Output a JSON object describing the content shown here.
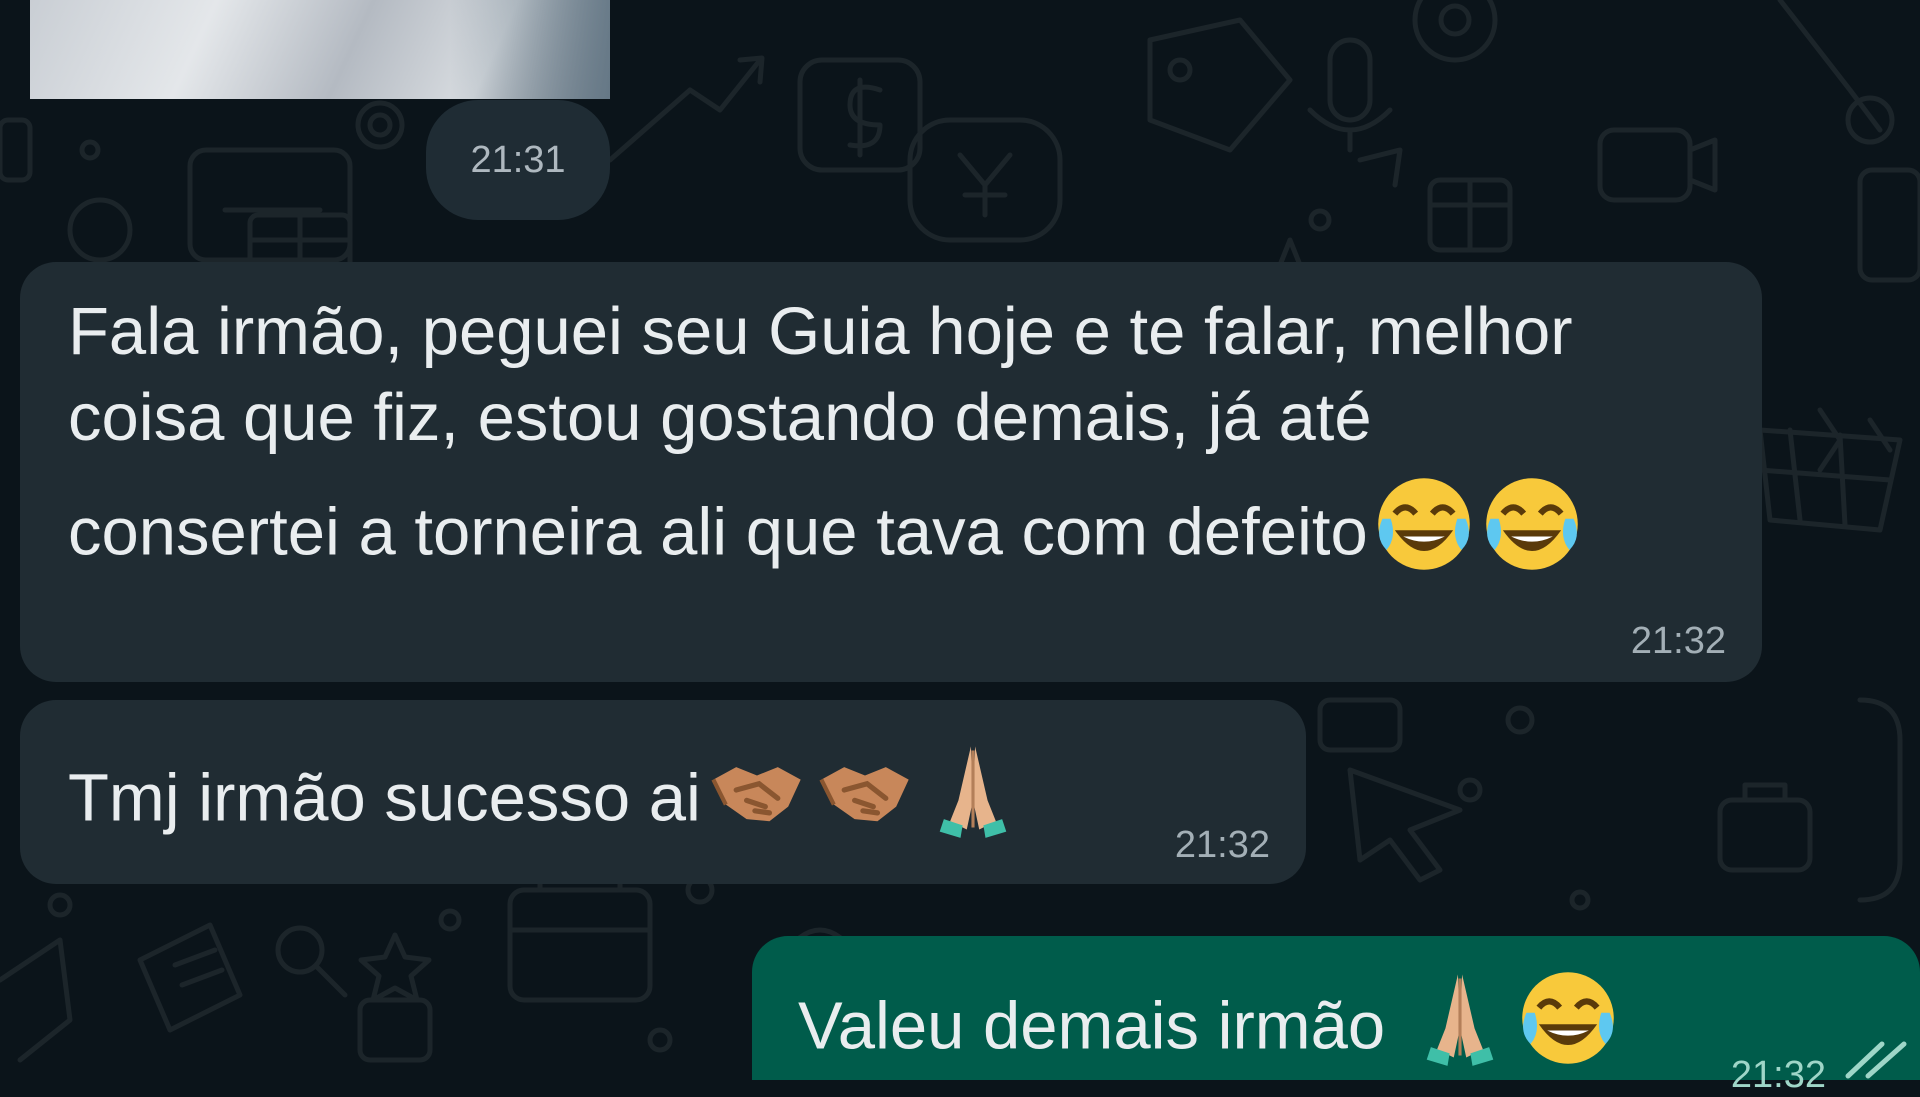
{
  "chat": {
    "media_time": "21:31",
    "messages": [
      {
        "direction": "incoming",
        "lines": [
          "Fala irmão, peguei seu Guia hoje e te falar, melhor",
          "coisa que fiz, estou gostando demais, já até",
          "consertei a torneira ali que tava com defeito"
        ],
        "emoji": [
          "face-with-tears-of-joy-icon",
          "face-with-tears-of-joy-icon"
        ],
        "time": "21:32"
      },
      {
        "direction": "incoming",
        "lines": [
          "Tmj irmão sucesso ai"
        ],
        "emoji": [
          "handshake-icon",
          "handshake-icon",
          "folded-hands-icon"
        ],
        "time": "21:32"
      },
      {
        "direction": "outgoing",
        "lines": [
          "Valeu demais irmão "
        ],
        "emoji": [
          "folded-hands-icon",
          "face-with-tears-of-joy-icon"
        ],
        "time": "21:32",
        "status": "double-check-icon"
      }
    ]
  },
  "colors": {
    "background": "#0b141a",
    "incoming_bubble": "#202c33",
    "outgoing_bubble": "#005c4b",
    "text": "#e9edef",
    "timestamp": "#a3afb6"
  }
}
